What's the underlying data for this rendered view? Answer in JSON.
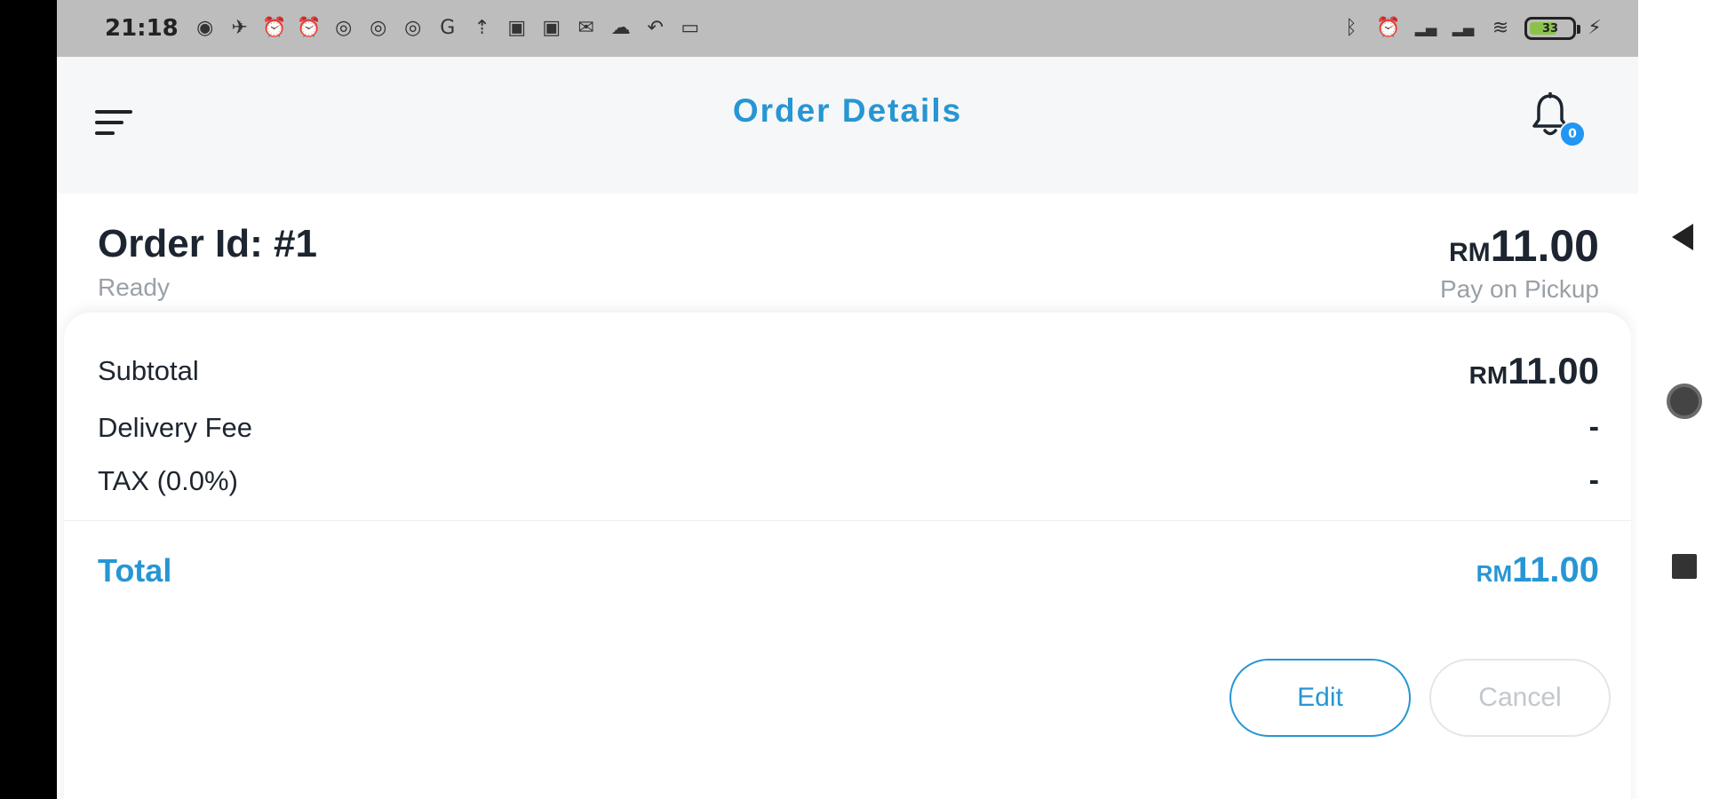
{
  "status_bar": {
    "time": "21:18",
    "left_icons": [
      "whatsapp-icon",
      "telegram-icon",
      "alarm-icon",
      "alarm-icon",
      "app-icon",
      "app-icon",
      "app-icon",
      "google-icon",
      "upload-icon",
      "shop-icon",
      "shop-icon",
      "mail-icon",
      "messenger-icon",
      "missed-call-icon",
      "sms-icon"
    ],
    "left_glyphs": [
      "◉",
      "✈",
      "⏰",
      "⏰",
      "◎",
      "◎",
      "◎",
      "G",
      "⇡",
      "▣",
      "▣",
      "✉",
      "☁",
      "↶",
      "▭"
    ],
    "right_icons": [
      "bluetooth-icon",
      "alarm-icon",
      "signal-icon",
      "signal-icon",
      "wifi-icon"
    ],
    "right_glyphs": [
      "ᛒ",
      "⏰",
      "▂▄",
      "▂▄",
      "≋"
    ],
    "battery_level": "33",
    "charging_glyph": "⚡"
  },
  "header": {
    "title": "Order Details",
    "notification_count": "0"
  },
  "order": {
    "id_label": "Order Id: #1",
    "status": "Ready",
    "currency": "RM",
    "amount": "11.00",
    "payment_method": "Pay on Pickup"
  },
  "summary": {
    "subtotal_label": "Subtotal",
    "subtotal_currency": "RM",
    "subtotal_amount": "11.00",
    "delivery_label": "Delivery Fee",
    "delivery_value": "-",
    "tax_label": "TAX (0.0%)",
    "tax_value": "-",
    "total_label": "Total",
    "total_currency": "RM",
    "total_amount": "11.00"
  },
  "actions": {
    "edit_label": "Edit",
    "cancel_label": "Cancel"
  },
  "colors": {
    "accent": "#2796d3",
    "text_dark": "#1d2530",
    "text_muted": "#9aa0a6",
    "status_bar": "#bdbdbd",
    "header_bg": "#f6f7f8"
  }
}
